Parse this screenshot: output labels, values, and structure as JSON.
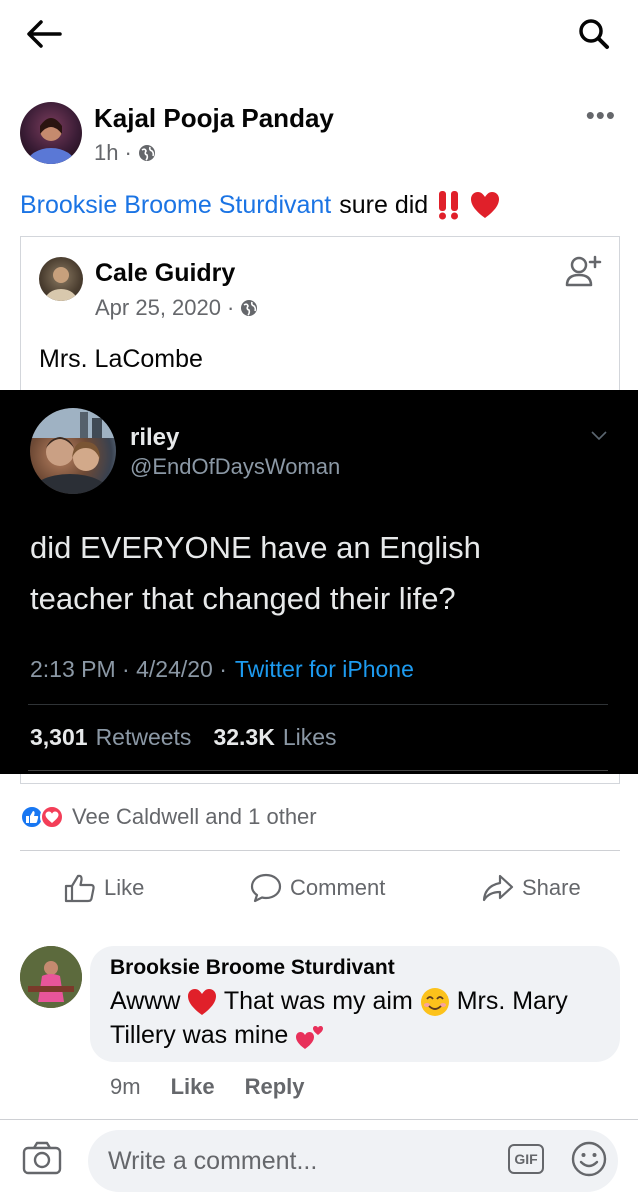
{
  "post": {
    "author": "Kajal Pooja Panday",
    "time": "1h",
    "separator": "·",
    "mention": "Brooksie Broome Sturdivant",
    "text": "sure did",
    "more": "•••"
  },
  "shared": {
    "author": "Cale Guidry",
    "date": "Apr 25, 2020",
    "separator": "·",
    "text": "Mrs. LaCombe"
  },
  "tweet": {
    "name": "riley",
    "handle": "@EndOfDaysWoman",
    "text": "did EVERYONE have an English teacher that changed their life?",
    "time": "2:13 PM · 4/24/20 ·",
    "source": "Twitter for iPhone",
    "retweets": "3,301",
    "retweets_label": "Retweets",
    "likes": "32.3K",
    "likes_label": "Likes"
  },
  "reactions": {
    "text": "Vee Caldwell and 1 other"
  },
  "actions": {
    "like": "Like",
    "comment": "Comment",
    "share": "Share"
  },
  "comment": {
    "author": "Brooksie Broome Sturdivant",
    "part1": "Awww",
    "part2": "That was my aim",
    "part3": "Mrs. Mary Tillery was mine",
    "time": "9m",
    "like": "Like",
    "reply": "Reply"
  },
  "composer": {
    "placeholder": "Write a comment...",
    "gif": "GIF"
  },
  "colors": {
    "link": "#1b74e4",
    "secondary": "#65676b",
    "tweet_bg": "#000000",
    "twitter_blue": "#1d9bf0"
  }
}
